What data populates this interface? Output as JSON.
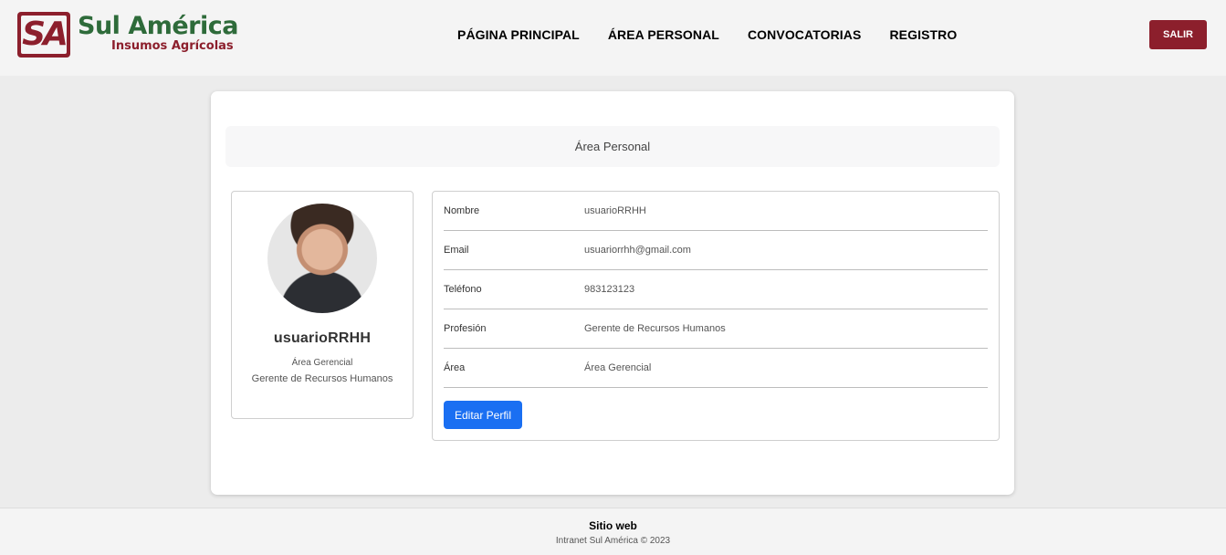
{
  "brand": {
    "badge": "SA",
    "title": "Sul América",
    "subtitle": "Insumos Agrícolas"
  },
  "nav": {
    "items": [
      "PÁGINA PRINCIPAL",
      "ÁREA PERSONAL",
      "CONVOCATORIAS",
      "REGISTRO"
    ],
    "logout_label": "SALIR"
  },
  "card": {
    "title": "Área Personal"
  },
  "profile": {
    "name": "usuarioRRHH",
    "area": "Área Gerencial",
    "profession": "Gerente de Recursos Humanos"
  },
  "details": {
    "rows": [
      {
        "label": "Nombre",
        "value": "usuarioRRHH"
      },
      {
        "label": "Email",
        "value": "usuariorrhh@gmail.com"
      },
      {
        "label": "Teléfono",
        "value": "983123123"
      },
      {
        "label": "Profesión",
        "value": "Gerente de Recursos Humanos"
      },
      {
        "label": "Área",
        "value": "Área Gerencial"
      }
    ],
    "edit_label": "Editar Perfil"
  },
  "footer": {
    "title": "Sitio web",
    "copyright": "Intranet Sul América © 2023"
  },
  "colors": {
    "brand_red": "#8c1f2c",
    "brand_green": "#2e6b3a",
    "primary_blue": "#1a6ff2"
  }
}
